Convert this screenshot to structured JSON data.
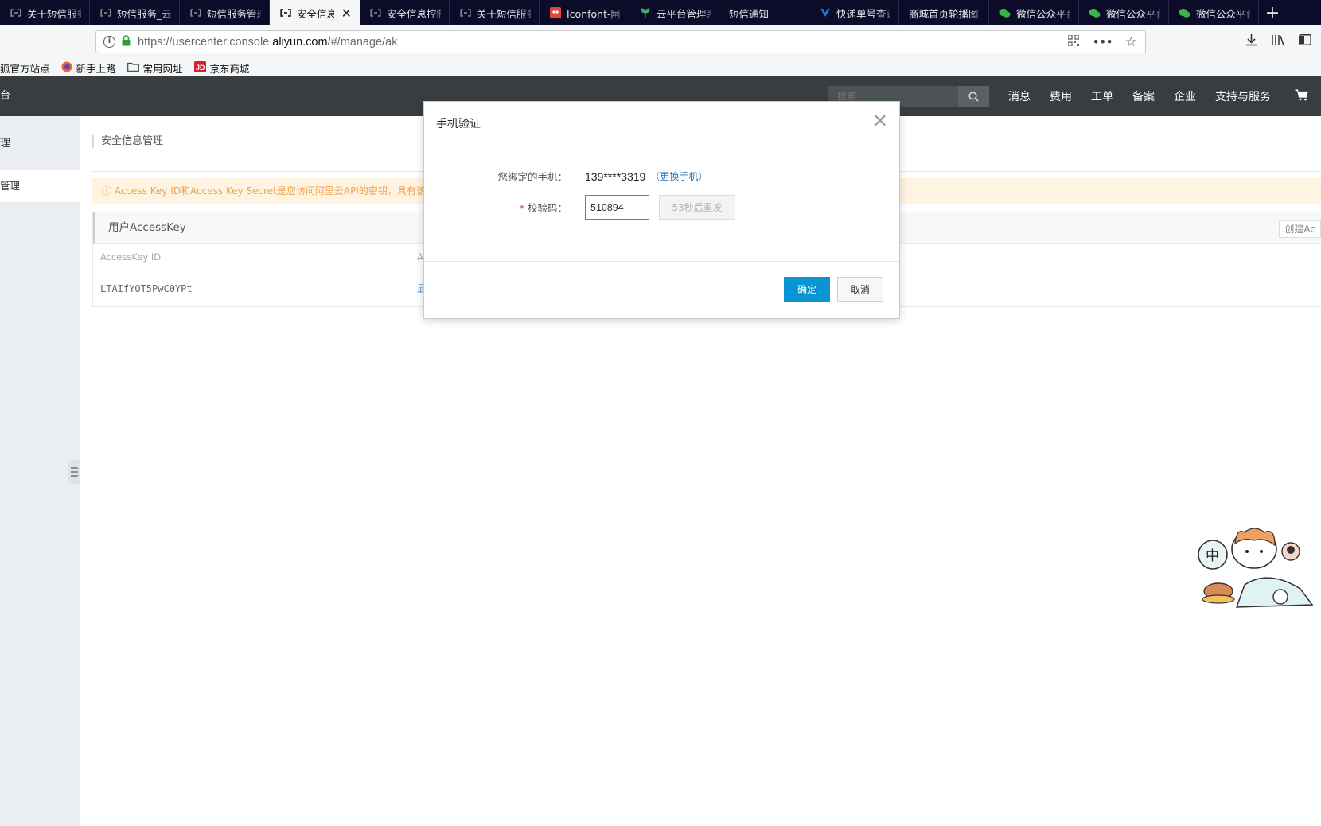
{
  "browser": {
    "tabs": [
      {
        "title": "关于短信服务",
        "favicon": "aliyun-icon",
        "active": false
      },
      {
        "title": "短信服务_云",
        "favicon": "aliyun-icon",
        "active": false
      },
      {
        "title": "短信服务管理",
        "favicon": "aliyun-icon",
        "active": false
      },
      {
        "title": "安全信息",
        "favicon": "aliyun-icon",
        "active": true
      },
      {
        "title": "安全信息控制",
        "favicon": "aliyun-icon",
        "active": false
      },
      {
        "title": "关于短信服务",
        "favicon": "aliyun-icon",
        "active": false
      },
      {
        "title": "Iconfont-阿里",
        "favicon": "iconfont-icon",
        "active": false
      },
      {
        "title": "云平台管理系",
        "favicon": "plant-icon",
        "active": false
      },
      {
        "title": "短信通知",
        "favicon": "",
        "active": false
      },
      {
        "title": "快递单号查询",
        "favicon": "v-icon",
        "active": false
      },
      {
        "title": "商城首页轮播图",
        "favicon": "",
        "active": false
      },
      {
        "title": "微信公众平台",
        "favicon": "wechat-icon",
        "active": false
      },
      {
        "title": "微信公众平台",
        "favicon": "wechat-icon",
        "active": false
      },
      {
        "title": "微信公众平台",
        "favicon": "wechat-icon",
        "active": false
      }
    ],
    "url_prefix": "https://usercenter.console.",
    "url_domain": "aliyun.com",
    "url_suffix": "/#/manage/ak",
    "bookmarks": [
      {
        "label": "狐官方站点",
        "icon": ""
      },
      {
        "label": "新手上路",
        "icon": "firefox-icon"
      },
      {
        "label": "常用网址",
        "icon": "folder-icon"
      },
      {
        "label": "京东商城",
        "icon": "jd-icon"
      }
    ]
  },
  "console": {
    "brand_fragment": "台",
    "search_placeholder": "搜索",
    "top_menu": [
      "消息",
      "费用",
      "工单",
      "备案",
      "企业",
      "支持与服务"
    ],
    "sidebar_head": "理",
    "sidebar_item": "管理",
    "breadcrumb": "安全信息管理",
    "warning": "ⓘ Access Key ID和Access Key Secret是您访问阿里云API的密钥，具有该账",
    "panel_title": "用户AccessKey",
    "create_button": "创建Ac",
    "col_accesskey": "AccessKey ID",
    "col_second": "A",
    "row_accesskey": "LTAIfYOT5PwC0YPt",
    "row_show": "显"
  },
  "modal": {
    "title": "手机验证",
    "phone_label": "您绑定的手机：",
    "phone_value": "139****3319",
    "change_open": "（",
    "change_link": "更换手机",
    "change_close": "）",
    "code_label": "校验码：",
    "code_value": "510894",
    "resend_label": "53秒后重发",
    "ok_label": "确定",
    "cancel_label": "取消"
  },
  "colors": {
    "topnav": "#373d41",
    "primary_button": "#0a94d4",
    "input_focus": "#3aa34b",
    "required": "#e4393c"
  }
}
